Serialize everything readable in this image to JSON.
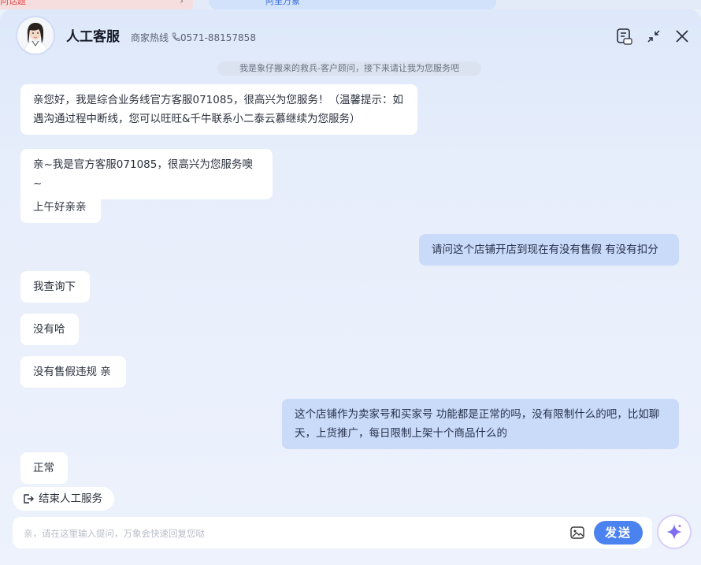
{
  "background": {
    "tab_left": "问话题",
    "tab_center": "阿里万象"
  },
  "header": {
    "title": "人工客服",
    "hotline_label": "商家热线",
    "hotline_number": "0571-88157858",
    "icons": [
      "avatar",
      "phone-icon",
      "note-icon",
      "minimize-icon",
      "close-icon"
    ]
  },
  "system_note": "我是象仔搬来的救兵-客户顾问，接下来请让我为您服务吧",
  "messages": [
    {
      "side": "in",
      "text": "亲您好，我是综合业务线官方客服071085，很高兴为您服务！（温馨提示：如遇沟通过程中断线，您可以旺旺&千牛联系小二泰云慕继续为您服务）"
    },
    {
      "side": "in",
      "text": "亲~我是官方客服071085，很高兴为您服务噢~"
    },
    {
      "side": "in",
      "text": "上午好亲亲"
    },
    {
      "side": "out",
      "text": "请问这个店铺开店到现在有没有售假 有没有扣分"
    },
    {
      "side": "in",
      "text": "我查询下"
    },
    {
      "side": "in",
      "text": "没有哈"
    },
    {
      "side": "in",
      "text": "没有售假违规 亲"
    },
    {
      "side": "out",
      "text": "这个店铺作为卖家号和买家号 功能都是正常的吗，没有限制什么的吧，比如聊天，上货推广，每日限制上架十个商品什么的"
    },
    {
      "side": "in",
      "text": "正常"
    }
  ],
  "footer": {
    "end_service_label": "结束人工服务",
    "input_placeholder": "亲，请在这里输入提问，万象会快速回复您哒",
    "send_label": "发送"
  },
  "colors": {
    "accent": "#4a82f0",
    "outgoing_bubble": "#c9dbf9",
    "incoming_bubble": "#ffffff"
  }
}
